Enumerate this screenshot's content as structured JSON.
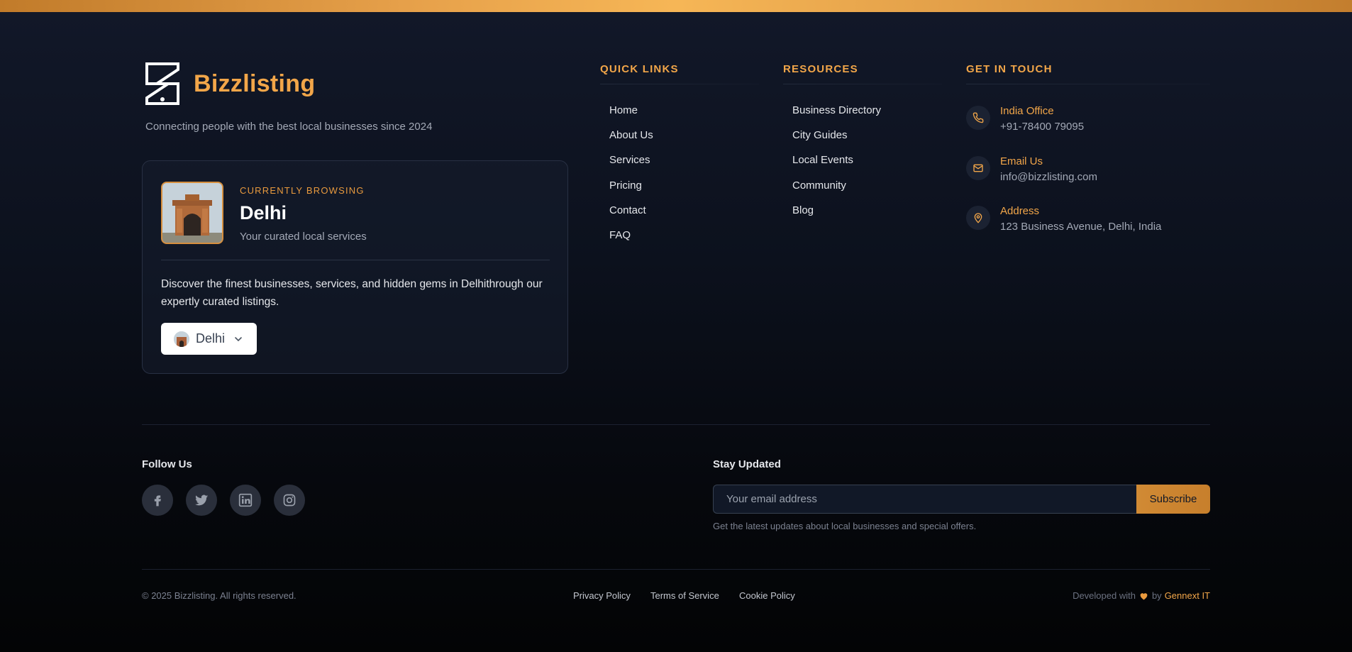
{
  "brand": {
    "name": "Bizzlisting",
    "tagline": "Connecting people with the best local businesses since 2024"
  },
  "city_card": {
    "label": "Currently Browsing",
    "city": "Delhi",
    "subtitle": "Your curated local services",
    "description": "Discover the finest businesses, services, and hidden gems in Delhithrough our expertly curated listings.",
    "selector_value": "Delhi"
  },
  "quick_links": {
    "title": "Quick Links",
    "items": [
      "Home",
      "About Us",
      "Services",
      "Pricing",
      "Contact",
      "FAQ"
    ]
  },
  "resources": {
    "title": "Resources",
    "items": [
      "Business Directory",
      "City Guides",
      "Local Events",
      "Community",
      "Blog"
    ]
  },
  "contact": {
    "title": "Get In Touch",
    "items": [
      {
        "title": "India Office",
        "value": "+91-78400 79095",
        "icon": "phone-icon"
      },
      {
        "title": "Email Us",
        "value": "info@bizzlisting.com",
        "icon": "mail-icon"
      },
      {
        "title": "Address",
        "value": "123 Business Avenue, Delhi, India",
        "icon": "map-pin-icon"
      }
    ]
  },
  "follow": {
    "title": "Follow Us",
    "icons": [
      "facebook-icon",
      "twitter-icon",
      "linkedin-icon",
      "instagram-icon"
    ]
  },
  "newsletter": {
    "title": "Stay Updated",
    "placeholder": "Your email address",
    "button": "Subscribe",
    "hint": "Get the latest updates about local businesses and special offers."
  },
  "bottom": {
    "copyright": "© 2025 Bizzlisting. All rights reserved.",
    "legal": [
      "Privacy Policy",
      "Terms of Service",
      "Cookie Policy"
    ],
    "developed_prefix": "Developed with",
    "developed_by": "by",
    "company": "Gennext IT"
  },
  "colors": {
    "accent": "#f2a649",
    "background": "#0c111d",
    "top_bar": "#f6b656"
  }
}
